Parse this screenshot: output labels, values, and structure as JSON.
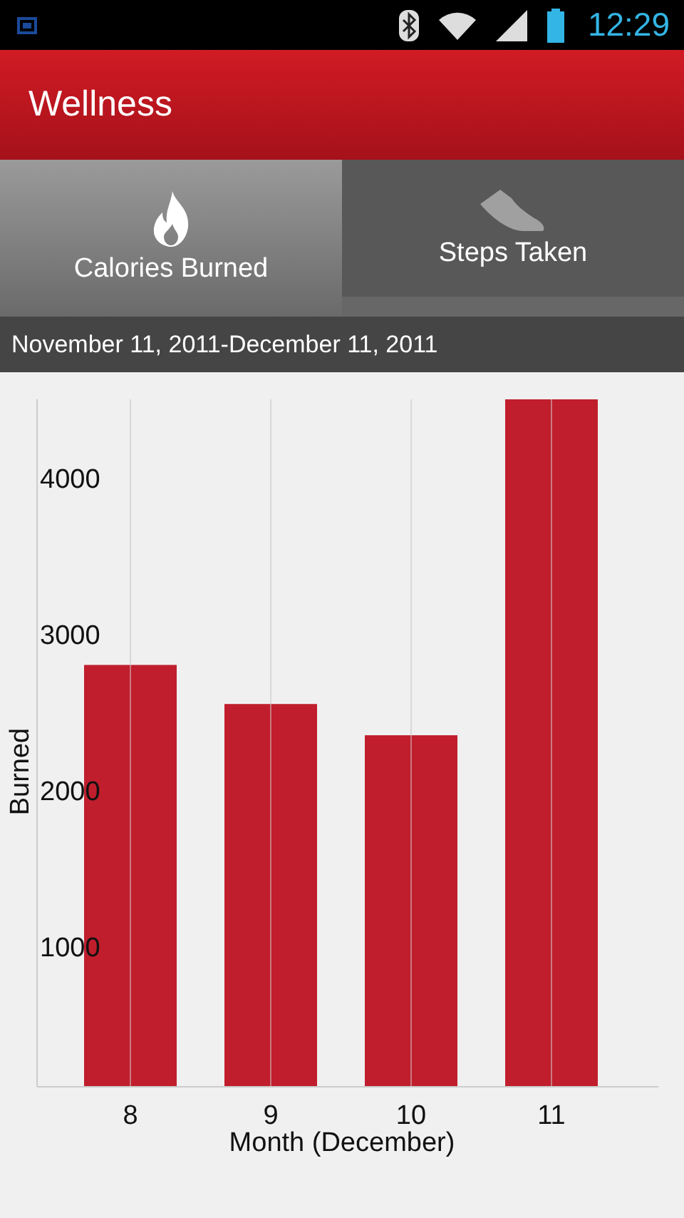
{
  "status_bar": {
    "time": "12:29"
  },
  "app_bar": {
    "title": "Wellness"
  },
  "tabs": [
    {
      "label": "Calories Burned",
      "selected": true
    },
    {
      "label": "Steps Taken",
      "selected": false
    }
  ],
  "date_range": "November 11, 2011-December 11, 2011",
  "chart_data": {
    "type": "bar",
    "xlabel": "Month (December)",
    "ylabel": "Burned",
    "categories": [
      "8",
      "9",
      "10",
      "11"
    ],
    "values": [
      2800,
      2550,
      2350,
      4500
    ],
    "grid": true,
    "ylim": [
      100,
      4500
    ],
    "yticks": [
      1000,
      2000,
      3000,
      4000
    ]
  }
}
